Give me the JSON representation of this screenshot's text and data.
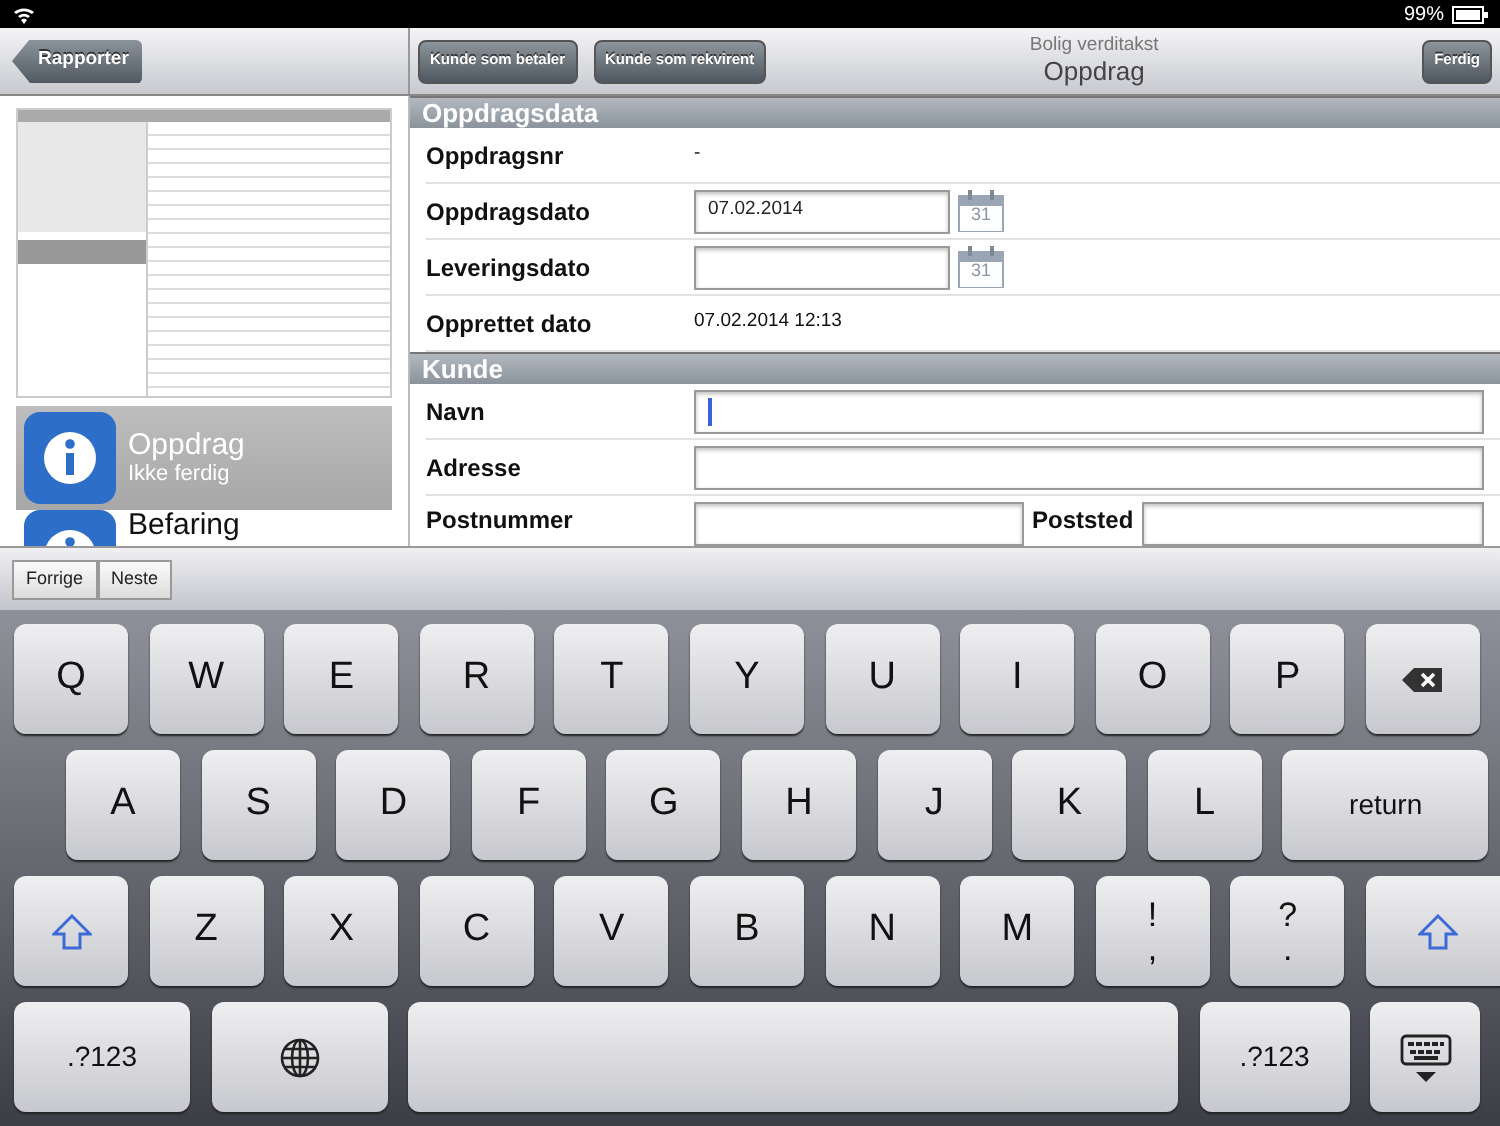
{
  "status_bar": {
    "battery": "99%"
  },
  "nav_bar": {
    "back": "Rapporter",
    "buttons": [
      "Kunde som betaler",
      "Kunde som rekvirent"
    ],
    "subtitle": "Bolig verditakst",
    "title": "Oppdrag",
    "done": "Ferdig"
  },
  "sidebar": {
    "items": [
      {
        "title": "Oppdrag",
        "subtitle": "Ikke ferdig",
        "selected": true
      },
      {
        "title": "Befaring",
        "selected": false
      }
    ]
  },
  "sections": [
    {
      "title": "Oppdragsdata",
      "rows": [
        {
          "kind": "text",
          "label": "Oppdragsnr",
          "value": "-"
        },
        {
          "kind": "date",
          "label": "Oppdragsdato",
          "value": "07.02.2014",
          "icon_text": "31"
        },
        {
          "kind": "date",
          "label": "Leveringsdato",
          "icon_text": "31"
        },
        {
          "kind": "text",
          "label": "Opprettet dato",
          "value": "07.02.2014 12:13"
        }
      ]
    },
    {
      "title": "Kunde",
      "rows": [
        {
          "kind": "input",
          "label": "Navn",
          "focused": true
        },
        {
          "kind": "input",
          "label": "Adresse",
          "focused": false
        },
        {
          "kind": "split",
          "label": "Postnummer",
          "label2": "Poststed"
        }
      ]
    }
  ],
  "accessory": {
    "buttons": [
      "Forrige",
      "Neste"
    ]
  },
  "keyboard": {
    "rows": [
      {
        "keys": [
          {
            "kind": "letter",
            "label": "Q"
          },
          {
            "kind": "letter",
            "label": "W"
          },
          {
            "kind": "letter",
            "label": "E"
          },
          {
            "kind": "letter",
            "label": "R"
          },
          {
            "kind": "letter",
            "label": "T"
          },
          {
            "kind": "letter",
            "label": "Y"
          },
          {
            "kind": "letter",
            "label": "U"
          },
          {
            "kind": "letter",
            "label": "I"
          },
          {
            "kind": "letter",
            "label": "O"
          },
          {
            "kind": "letter",
            "label": "P"
          },
          {
            "kind": "backspace"
          }
        ]
      },
      {
        "keys": [
          {
            "kind": "letter",
            "label": "A"
          },
          {
            "kind": "letter",
            "label": "S"
          },
          {
            "kind": "letter",
            "label": "D"
          },
          {
            "kind": "letter",
            "label": "F"
          },
          {
            "kind": "letter",
            "label": "G"
          },
          {
            "kind": "letter",
            "label": "H"
          },
          {
            "kind": "letter",
            "label": "J"
          },
          {
            "kind": "letter",
            "label": "K"
          },
          {
            "kind": "letter",
            "label": "L"
          },
          {
            "kind": "wide",
            "label": "return"
          }
        ]
      },
      {
        "keys": [
          {
            "kind": "shift"
          },
          {
            "kind": "letter",
            "label": "Z"
          },
          {
            "kind": "letter",
            "label": "X"
          },
          {
            "kind": "letter",
            "label": "C"
          },
          {
            "kind": "letter",
            "label": "V"
          },
          {
            "kind": "letter",
            "label": "B"
          },
          {
            "kind": "letter",
            "label": "N"
          },
          {
            "kind": "letter",
            "label": "M"
          },
          {
            "kind": "dual",
            "label": "!",
            "label2": ","
          },
          {
            "kind": "dual",
            "label": "?",
            "label2": "."
          },
          {
            "kind": "shift"
          }
        ]
      },
      {
        "keys": [
          {
            "kind": "wide",
            "label": ".?123"
          },
          {
            "kind": "globe"
          },
          {
            "kind": "space"
          },
          {
            "kind": "wide",
            "label": ".?123"
          },
          {
            "kind": "hide"
          }
        ]
      }
    ]
  }
}
